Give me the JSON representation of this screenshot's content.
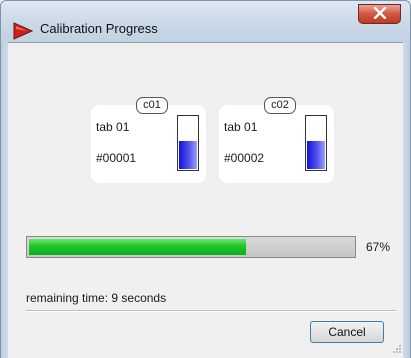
{
  "window": {
    "title": "Calibration Progress",
    "title_icon": "red-arrow-icon",
    "close_icon": "close-icon"
  },
  "cards": [
    {
      "label": "c01",
      "tab": "tab 01",
      "id": "#00001",
      "gauge_level": 0.55
    },
    {
      "label": "c02",
      "tab": "tab 01",
      "id": "#00002",
      "gauge_level": 0.55
    }
  ],
  "progress": {
    "value": 67,
    "percent_text": "67%"
  },
  "remaining": {
    "prefix": "remaining time: ",
    "value": "9",
    "unit": " seconds"
  },
  "buttons": {
    "cancel_label": "Cancel"
  },
  "colors": {
    "progress_fill": "#1ec62a",
    "gauge_fill": "#1010d8",
    "close_button": "#c13a22"
  }
}
